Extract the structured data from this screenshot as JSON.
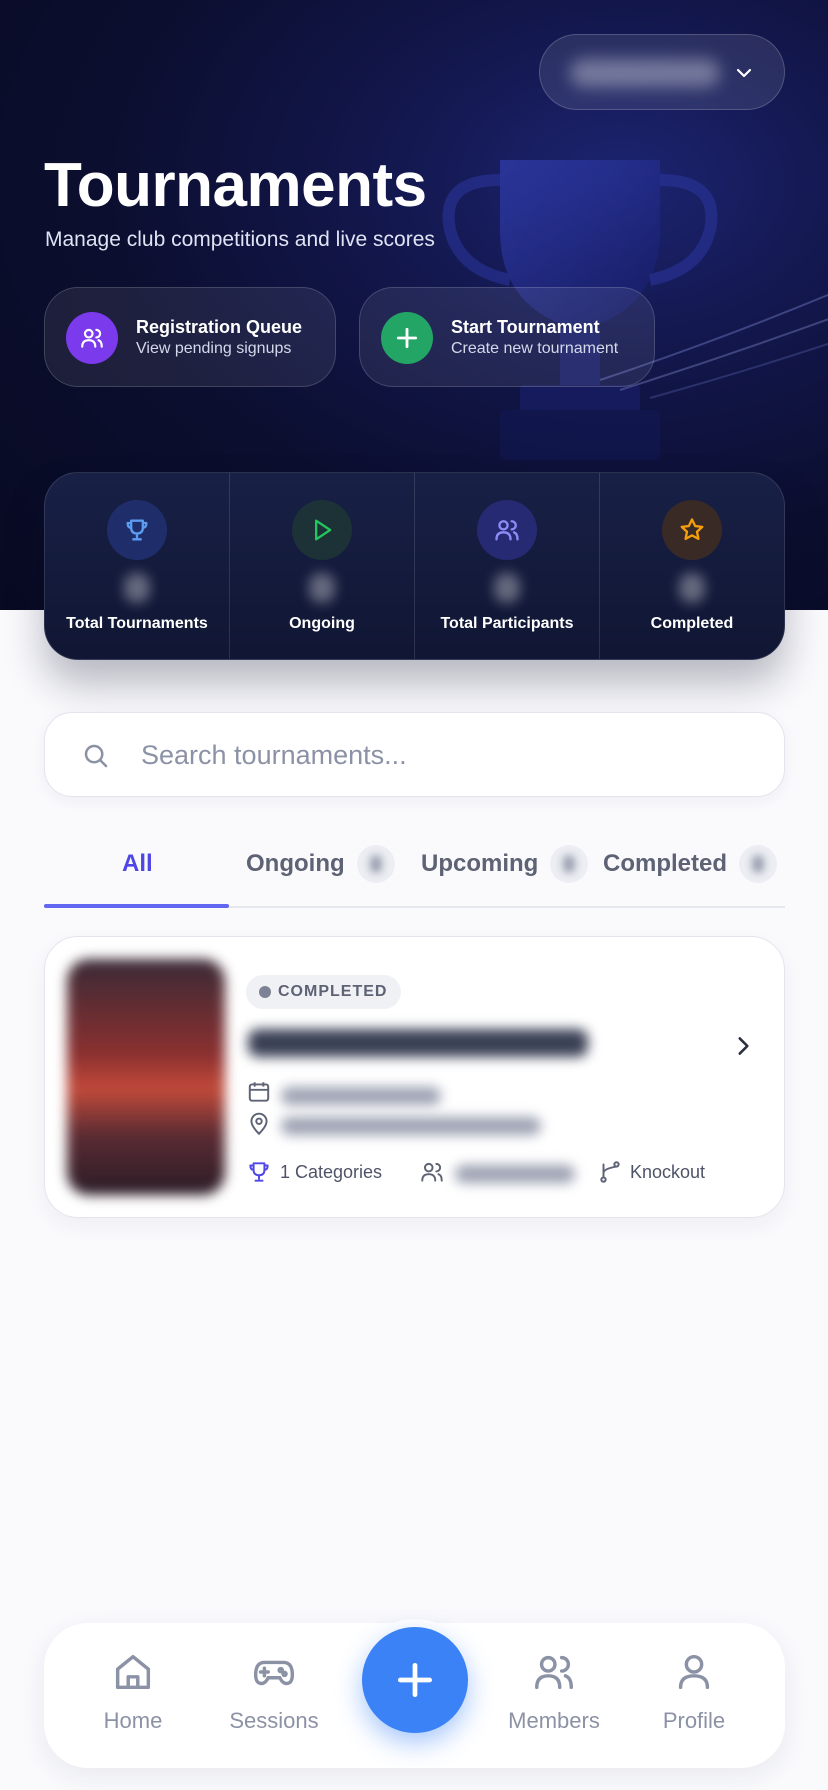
{
  "header": {
    "title": "Tournaments",
    "subtitle": "Manage club competitions and live scores",
    "club_selector": {
      "icon": "chevron-down-icon"
    }
  },
  "actions": [
    {
      "title": "Registration Queue",
      "subtitle": "View pending signups",
      "icon": "users-icon",
      "color": "#7c3aed"
    },
    {
      "title": "Start Tournament",
      "subtitle": "Create new tournament",
      "icon": "plus-icon",
      "color": "#22a565"
    }
  ],
  "stats": [
    {
      "label": "Total Tournaments",
      "icon": "trophy-icon",
      "color": "#5b9bf0"
    },
    {
      "label": "Ongoing",
      "icon": "play-icon",
      "color": "#22c55e"
    },
    {
      "label": "Total Participants",
      "icon": "users-icon",
      "color": "#8b8cf8"
    },
    {
      "label": "Completed",
      "icon": "star-icon",
      "color": "#f59e0b"
    }
  ],
  "search": {
    "placeholder": "Search tournaments...",
    "value": ""
  },
  "tabs": [
    {
      "label": "All",
      "active": true
    },
    {
      "label": "Ongoing"
    },
    {
      "label": "Upcoming"
    },
    {
      "label": "Completed"
    }
  ],
  "tournaments": [
    {
      "status": "COMPLETED",
      "categories": "1 Categories",
      "format": "Knockout"
    }
  ],
  "bottom_nav": {
    "items": [
      {
        "label": "Home",
        "icon": "home-icon"
      },
      {
        "label": "Sessions",
        "icon": "gamepad-icon"
      },
      {
        "label": "Members",
        "icon": "users-icon"
      },
      {
        "label": "Profile",
        "icon": "user-icon"
      }
    ],
    "fab_icon": "plus-icon"
  },
  "colors": {
    "accent": "#4f46e5",
    "fab": "#3b82f6",
    "hero_bg": "#0b0e2e"
  }
}
